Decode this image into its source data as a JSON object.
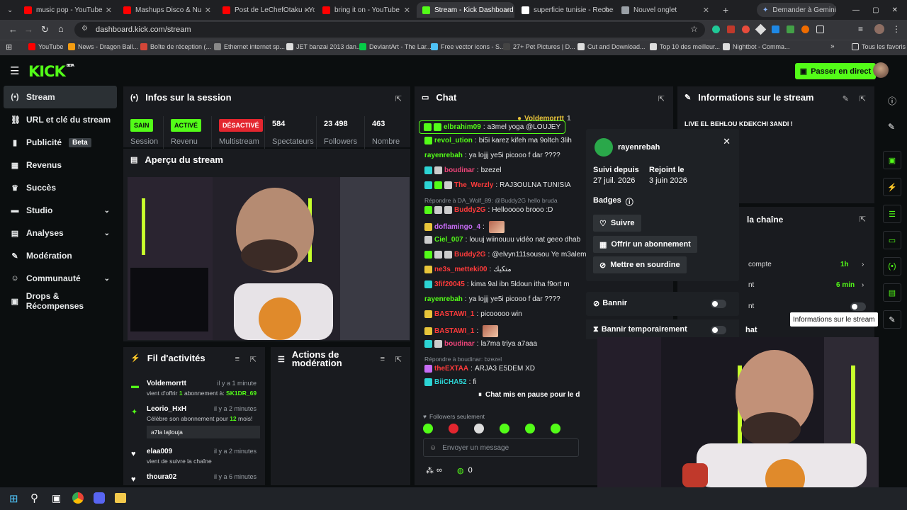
{
  "browser": {
    "tabs": [
      {
        "title": "music pop - YouTube",
        "color": "#ff0000"
      },
      {
        "title": "Mashups Disco & Nu",
        "color": "#ff0000"
      },
      {
        "title": "Post de LeChefOtaku - Yo",
        "color": "#ff0000"
      },
      {
        "title": "bring it on - YouTube",
        "color": "#ff0000"
      },
      {
        "title": "Stream - Kick Dashboard",
        "color": "#53fc18"
      },
      {
        "title": "superficie tunisie - Recher",
        "color": "#ffffff"
      },
      {
        "title": "Nouvel onglet",
        "color": "#9aa0a6"
      }
    ],
    "gemini_label": "Demander à Gemini",
    "url": "dashboard.kick.com/stream",
    "bookmarks": [
      "YouTube",
      "News - Dragon Ball...",
      "Boîte de réception (...",
      "Ethernet internet sp...",
      "JET banzai 2013 dan...",
      "DeviantArt - The Lar...",
      "Free vector icons - S...",
      "27+ Pet Pictures | D...",
      "Cut and Download...",
      "Top 10 des meilleur...",
      "Nightbot - Comma..."
    ],
    "all_favorites": "Tous les favoris"
  },
  "kick": {
    "logo": "KICK",
    "logo_beta": "BETA",
    "go_live": "Passer en direct"
  },
  "sidebar": {
    "items": [
      {
        "label": "Stream",
        "icon": "live-icon",
        "glyph": "(•)"
      },
      {
        "label": "URL et clé du stream",
        "icon": "link-icon",
        "glyph": "⛓"
      },
      {
        "label": "Publicité",
        "icon": "ad-icon",
        "glyph": "▮",
        "badge": "Beta"
      },
      {
        "label": "Revenus",
        "icon": "revenue-icon",
        "glyph": "▦"
      },
      {
        "label": "Succès",
        "icon": "trophy-icon",
        "glyph": "♛"
      },
      {
        "label": "Studio",
        "icon": "studio-icon",
        "glyph": "▬",
        "chevron": true
      },
      {
        "label": "Analyses",
        "icon": "analytics-icon",
        "glyph": "▤",
        "chevron": true
      },
      {
        "label": "Modération",
        "icon": "wrench-icon",
        "glyph": "✎"
      },
      {
        "label": "Communauté",
        "icon": "community-icon",
        "glyph": "☺",
        "chevron": true
      },
      {
        "label": "Drops & Récompenses",
        "icon": "drops-icon",
        "glyph": "▣"
      }
    ]
  },
  "session": {
    "title": "Infos sur la session",
    "stats": [
      {
        "value": "SAIN",
        "label": "Session",
        "badge": true,
        "bg": "#53fc18",
        "fg": "#0b0e0f"
      },
      {
        "value": "ACTIVÉ",
        "label": "Revenu",
        "badge": true,
        "bg": "#53fc18",
        "fg": "#0b0e0f"
      },
      {
        "value": "DÉSACTIVÉ",
        "label": "Multistream",
        "badge": true,
        "bg": "#e3262f",
        "fg": "#ffffff"
      },
      {
        "value": "584",
        "label": "Spectateurs"
      },
      {
        "value": "23 498",
        "label": "Followers"
      },
      {
        "value": "463",
        "label": "Nombre"
      }
    ]
  },
  "preview": {
    "title": "Aperçu du stream"
  },
  "activity": {
    "title": "Fil d'activités",
    "items": [
      {
        "user": "Voldemorrtt",
        "time": "il y a 1 minute",
        "desc_pre": "vient d'offrir ",
        "desc_num": "1",
        "desc_mid": " abonnement à: ",
        "desc_target": "SK1DR_69"
      },
      {
        "user": "Leorio_HxH",
        "time": "il y a 2 minutes",
        "desc_pre": "Célèbre son abonnement pour ",
        "desc_num": "12",
        "desc_mid": " mois!",
        "message": "a7la lajlouja"
      },
      {
        "user": "elaa009",
        "time": "il y a 2 minutes",
        "desc": "vient de suivre la chaîne"
      },
      {
        "user": "thoura02",
        "time": "il y a 6 minutes"
      }
    ]
  },
  "modactions": {
    "title": "Actions de modération"
  },
  "chat": {
    "title": "Chat",
    "pinned_user": "Voldemorrtt",
    "pinned_count": "1",
    "lines": [
      {
        "user": "elbrahim09",
        "ucolor": "#53fc18",
        "text": "a3mel yoga @LOUJEY",
        "badges": [
          "#53fc18",
          "#53fc18"
        ],
        "highlight": true
      },
      {
        "user": "revol_ution",
        "ucolor": "#53fc18",
        "text": "bi5i karez kifeh ma 9oltch 3lih",
        "badges": [
          "#53fc18"
        ]
      },
      {
        "user": "rayenrebah",
        "ucolor": "#53fc18",
        "text": "ya lojjj ye5i picooo f dar ????",
        "badges": []
      },
      {
        "user": "boudinar",
        "ucolor": "#f0457a",
        "text": "bzezel",
        "badges": [
          "#2cd4d4",
          "#cccccc"
        ]
      },
      {
        "user": "The_Werzly",
        "ucolor": "#ff3b3b",
        "text": "RAJ3OULNA TUNISIA",
        "badges": [
          "#2cd4d4",
          "#53fc18",
          "#cccccc"
        ]
      },
      {
        "reply": "Répondre à DA_Wolf_89: @Buddy2G hello bruda"
      },
      {
        "user": "Buddy2G",
        "ucolor": "#ff3b3b",
        "text": "Hellooooo brooo :D",
        "badges": [
          "#53fc18",
          "#cccccc",
          "#cccccc"
        ]
      },
      {
        "user": "doflamingo_4",
        "ucolor": "#c76cf5",
        "text": "",
        "badges": [
          "#e8c53a"
        ],
        "emote": true
      },
      {
        "user": "Ciel_007",
        "ucolor": "#53fc18",
        "text": "louuj wiinouuu vidéo nat geeo dhab",
        "badges": [
          "#cccccc"
        ]
      },
      {
        "user": "Buddy2G",
        "ucolor": "#ff3b3b",
        "text": "@elvyn111sousou Ye m3alem",
        "badges": [
          "#53fc18",
          "#cccccc",
          "#cccccc"
        ]
      },
      {
        "user": "ne3s_metteki00",
        "ucolor": "#ff3b3b",
        "text": "متكيك",
        "badges": [
          "#e8c53a"
        ]
      },
      {
        "user": "3fif20045",
        "ucolor": "#ff3b3b",
        "text": "kima 9al ibn 5ldoun itha f9ort m",
        "badges": [
          "#2cd4d4"
        ]
      },
      {
        "user": "rayenrebah",
        "ucolor": "#53fc18",
        "text": "ya lojjj ye5i picooo f dar ????",
        "badges": []
      },
      {
        "user": "BASTAWI_1",
        "ucolor": "#ff3b3b",
        "text": "picooooo win",
        "badges": [
          "#e8c53a"
        ]
      },
      {
        "user": "BASTAWI_1",
        "ucolor": "#ff3b3b",
        "text": "",
        "badges": [
          "#e8c53a"
        ],
        "emote": true
      },
      {
        "user": "boudinar",
        "ucolor": "#f0457a",
        "text": "la7ma triya a7aaa",
        "badges": [
          "#2cd4d4",
          "#cccccc"
        ]
      },
      {
        "reply": "Répondre à boudinar: bzezel"
      },
      {
        "user": "theEXTAA",
        "ucolor": "#ff3b3b",
        "text": "ARJA3 E5DEM XD",
        "badges": [
          "#c76cf5"
        ]
      },
      {
        "user": "BiiCHA52",
        "ucolor": "#2cd4d4",
        "text": "fi",
        "badges": [
          "#2cd4d4"
        ]
      }
    ],
    "paused": "Chat mis en pause pour le d",
    "followers_only": "Followers seulement",
    "input_placeholder": "Envoyer un message",
    "points_value": "0",
    "infinity": "∞"
  },
  "popup": {
    "username": "rayenrebah",
    "follow_since_label": "Suivi depuis",
    "follow_since_value": "27 juil. 2026",
    "joined_label": "Rejoint le",
    "joined_value": "3 juin 2026",
    "badges_label": "Badges",
    "follow_button": "Suivre",
    "gift_button": "Offrir un abonnement",
    "mute_button": "Mettre en sourdine",
    "ban_label": "Bannir",
    "timeout_label": "Bannir temporairement"
  },
  "streaminfo": {
    "title": "Informations sur le stream",
    "text": "LIVE EL BEHLOU KDEKCHI 3ANDI !",
    "channel_title_partial": "la chaîne",
    "rows": [
      {
        "label": "compte",
        "value": "1h"
      },
      {
        "label": "nt",
        "value": "6 min"
      },
      {
        "label": "nt",
        "value": ""
      }
    ],
    "chat_partial": "hat",
    "tooltip": "Informations sur le stream"
  },
  "colors": {
    "accent": "#53fc18",
    "danger": "#e3262f"
  }
}
